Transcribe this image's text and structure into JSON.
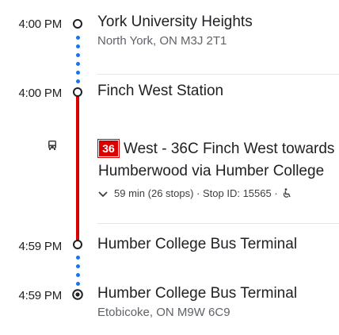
{
  "stops": [
    {
      "time": "4:00 PM",
      "name": "York University Heights",
      "address": "North York, ON M3J 2T1"
    },
    {
      "time": "4:00 PM",
      "name": "Finch West Station"
    },
    {
      "time": "4:59 PM",
      "name": "Humber College Bus Terminal"
    },
    {
      "time": "4:59 PM",
      "name": "Humber College Bus Terminal",
      "address": "Etobicoke, ON M9W 6C9"
    }
  ],
  "transit": {
    "mode_icon": "bus-icon",
    "route_number": "36",
    "route_description": "West - 36C Finch West towards Humberwood via Humber College",
    "details": "59 min (26 stops) · Stop ID: 15565 ·",
    "accessibility_icon": "wheelchair-icon",
    "route_color": "#db0000"
  },
  "colors": {
    "walk_dots": "#1a73e8",
    "text_primary": "#202124",
    "text_secondary": "#5f6368"
  }
}
